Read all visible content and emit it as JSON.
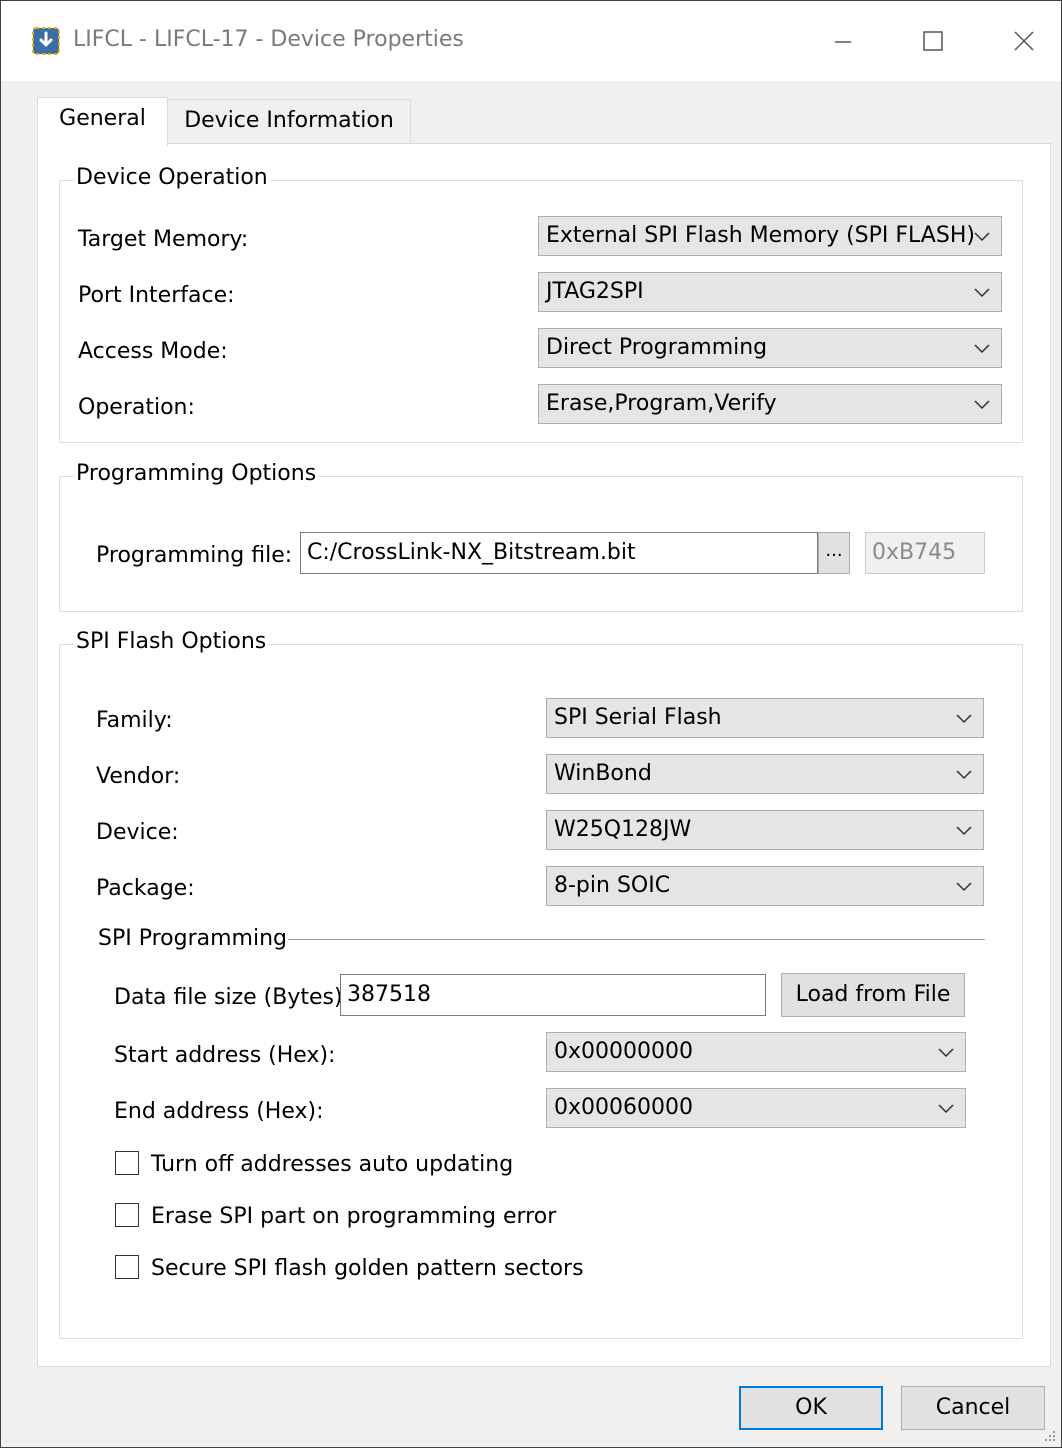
{
  "window": {
    "title": "LIFCL - LIFCL-17 - Device Properties",
    "controls": {
      "minimize": "—",
      "maximize": "☐",
      "close": "✕"
    }
  },
  "tabs": [
    {
      "label": "General",
      "selected": true
    },
    {
      "label": "Device Information",
      "selected": false
    }
  ],
  "device_operation": {
    "legend": "Device Operation",
    "target_memory": {
      "label": "Target Memory:",
      "value": "External SPI Flash Memory (SPI FLASH)"
    },
    "port_interface": {
      "label": "Port Interface:",
      "value": "JTAG2SPI"
    },
    "access_mode": {
      "label": "Access Mode:",
      "value": "Direct Programming"
    },
    "operation": {
      "label": "Operation:",
      "value": "Erase,Program,Verify"
    }
  },
  "programming_options": {
    "legend": "Programming Options",
    "file_label": "Programming file:",
    "file_value": "C:/CrossLink-NX_Bitstream.bit",
    "browse_label": "...",
    "checksum": "0xB745"
  },
  "spi_flash_options": {
    "legend": "SPI Flash Options",
    "family": {
      "label": "Family:",
      "value": "SPI Serial Flash"
    },
    "vendor": {
      "label": "Vendor:",
      "value": "WinBond"
    },
    "device": {
      "label": "Device:",
      "value": "W25Q128JW"
    },
    "package": {
      "label": "Package:",
      "value": "8-pin SOIC"
    },
    "spi_programming": {
      "heading": "SPI Programming",
      "data_size_label": "Data file size (Bytes):",
      "data_size_value": "387518",
      "load_button": "Load from File",
      "start_label": "Start address (Hex):",
      "start_value": "0x00000000",
      "end_label": "End address (Hex):",
      "end_value": "0x00060000"
    },
    "checkboxes": [
      {
        "label": "Turn off addresses auto updating",
        "checked": false
      },
      {
        "label": "Erase SPI part on programming error",
        "checked": false
      },
      {
        "label": "Secure SPI flash golden pattern sectors",
        "checked": false
      }
    ]
  },
  "buttons": {
    "ok": "OK",
    "cancel": "Cancel"
  },
  "colors": {
    "accent": "#0078d7",
    "panel": "#ffffff",
    "background": "#f0f0f0",
    "combo": "#e5e5e5"
  }
}
